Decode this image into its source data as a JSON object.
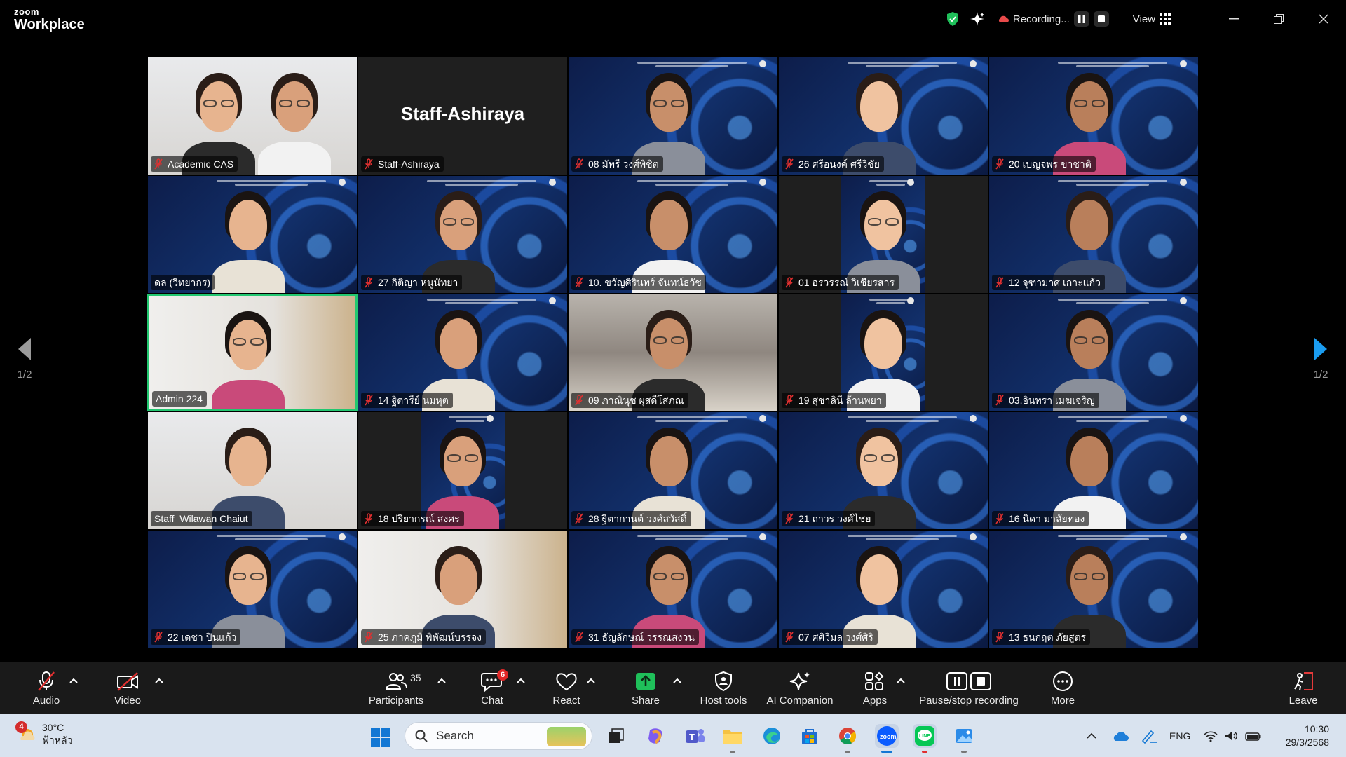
{
  "app": {
    "brand_small": "zoom",
    "brand_large": "Workplace"
  },
  "titlebar": {
    "recording_label": "Recording...",
    "view_label": "View"
  },
  "gallery": {
    "page_left": "1/2",
    "page_right": "1/2",
    "featured_name": "Staff-Ashiraya",
    "tiles": [
      {
        "name": "Academic CAS",
        "muted": true,
        "style": "room"
      },
      {
        "name": "Staff-Ashiraya",
        "muted": true,
        "style": "dark"
      },
      {
        "name": "08 มัทรี วงศ์พิชิต",
        "muted": true,
        "style": "blue"
      },
      {
        "name": "26 ศรีอนงค์ ศรีวิชัย",
        "muted": true,
        "style": "blue"
      },
      {
        "name": "20 เบญจพร ขาชาติ",
        "muted": true,
        "style": "blue"
      },
      {
        "name": "ดล (วิทยากร)",
        "muted": false,
        "style": "blue"
      },
      {
        "name": "27 กิติญา หนูนัทยา",
        "muted": true,
        "style": "blue"
      },
      {
        "name": "10. ขวัญศิรินทร์ จันทน์ธวัช",
        "muted": true,
        "style": "blue"
      },
      {
        "name": "01 อรวรรณ์ วิเชียรสาร",
        "muted": true,
        "style": "narrow"
      },
      {
        "name": "12 จุฑามาศ เกาะแก้ว",
        "muted": true,
        "style": "blue"
      },
      {
        "name": "Admin 224",
        "muted": false,
        "style": "room2",
        "active": true
      },
      {
        "name": "14 ฐิตารีย์ นมหุต",
        "muted": true,
        "style": "blue"
      },
      {
        "name": "09 ภาณินุช ผุสดีโสภณ",
        "muted": true,
        "style": "blur"
      },
      {
        "name": "19 สุชาลินี ล้านพยา",
        "muted": true,
        "style": "narrow"
      },
      {
        "name": "03.อินทรา เมฆเจริญ",
        "muted": true,
        "style": "blue"
      },
      {
        "name": "Staff_Wilawan Chaiut",
        "muted": false,
        "style": "room"
      },
      {
        "name": "18 ปริยากรณ์ สงศร",
        "muted": true,
        "style": "narrow"
      },
      {
        "name": "28 ฐิตากานต์ วงศ์สวัสดิ์",
        "muted": true,
        "style": "blue"
      },
      {
        "name": "21 ถาวร วงศ์ไชย",
        "muted": true,
        "style": "blue"
      },
      {
        "name": "16 นิดา มาลัยทอง",
        "muted": true,
        "style": "blue"
      },
      {
        "name": "22 เดชา ปินแก้ว",
        "muted": true,
        "style": "blue"
      },
      {
        "name": "25 ภาคภูมิ พิพัฒน์บรรจง",
        "muted": true,
        "style": "room2"
      },
      {
        "name": "31 ธัญลักษณ์ วรรณสงวน",
        "muted": true,
        "style": "blue"
      },
      {
        "name": "07 ศศิวิมล วงศ์ศิริ",
        "muted": true,
        "style": "blue"
      },
      {
        "name": "13 ธนกฤต ภัยสูตร",
        "muted": true,
        "style": "blue"
      }
    ]
  },
  "toolbar": {
    "audio": "Audio",
    "video": "Video",
    "participants": "Participants",
    "participants_count": "35",
    "chat": "Chat",
    "chat_badge": "6",
    "react": "React",
    "share": "Share",
    "host_tools": "Host tools",
    "ai_companion": "AI Companion",
    "apps": "Apps",
    "pause_recording": "Pause/stop recording",
    "more": "More",
    "leave": "Leave"
  },
  "taskbar": {
    "weather_temp": "30°C",
    "weather_desc": "ฟ้าหลัว",
    "weather_badge": "4",
    "search_placeholder": "Search",
    "lang": "ENG",
    "time": "10:30",
    "date": "29/3/2568"
  },
  "colors": {
    "active_speaker": "#22c770",
    "mute_red": "#e03030",
    "share_green": "#1fc05a",
    "leave_red": "#e33a3a"
  }
}
